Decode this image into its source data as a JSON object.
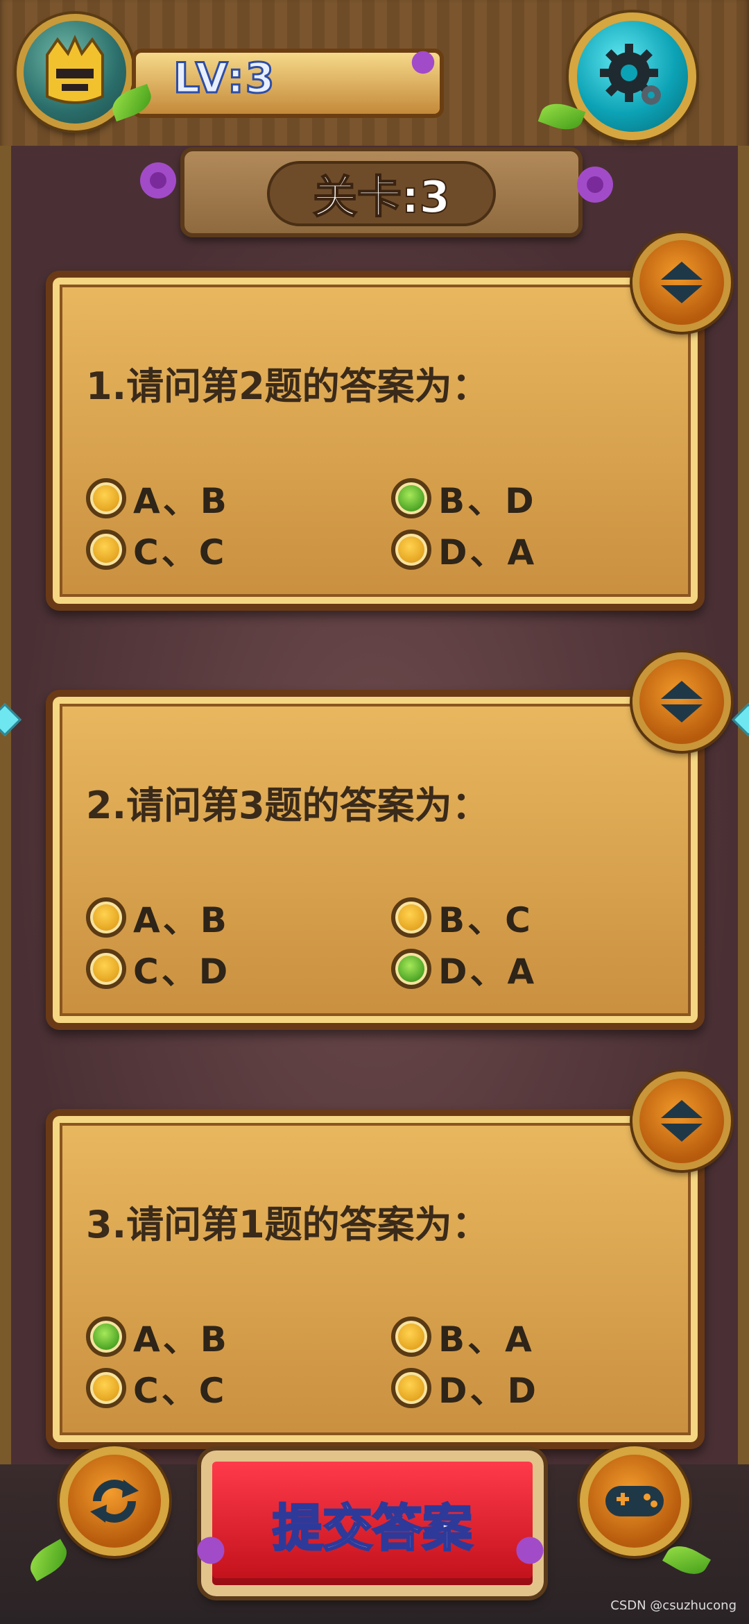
{
  "header": {
    "level_label": "LV:3",
    "stage_label": "关卡:3"
  },
  "questions": [
    {
      "text": "1.请问第2题的答案为：",
      "options": [
        {
          "label": "A、B",
          "selected": false
        },
        {
          "label": "B、D",
          "selected": true
        },
        {
          "label": "C、C",
          "selected": false
        },
        {
          "label": "D、A",
          "selected": false
        }
      ]
    },
    {
      "text": "2.请问第3题的答案为：",
      "options": [
        {
          "label": "A、B",
          "selected": false
        },
        {
          "label": "B、C",
          "selected": false
        },
        {
          "label": "C、D",
          "selected": false
        },
        {
          "label": "D、A",
          "selected": true
        }
      ]
    },
    {
      "text": "3.请问第1题的答案为：",
      "options": [
        {
          "label": "A、B",
          "selected": true
        },
        {
          "label": "B、A",
          "selected": false
        },
        {
          "label": "C、C",
          "selected": false
        },
        {
          "label": "D、D",
          "selected": false
        }
      ]
    }
  ],
  "footer": {
    "submit_label": "提交答案",
    "watermark": "CSDN @csuzhucong"
  },
  "icons": {
    "avatar": "knight-helmet-icon",
    "settings": "gear-icon",
    "collapse": "collapse-toggle-icon",
    "refresh": "refresh-icon",
    "game": "gamepad-icon"
  },
  "colors": {
    "card": "#e9b85f",
    "selected": "#3e9a1c",
    "submit": "#e01a28",
    "settings": "#0ca2b5"
  }
}
